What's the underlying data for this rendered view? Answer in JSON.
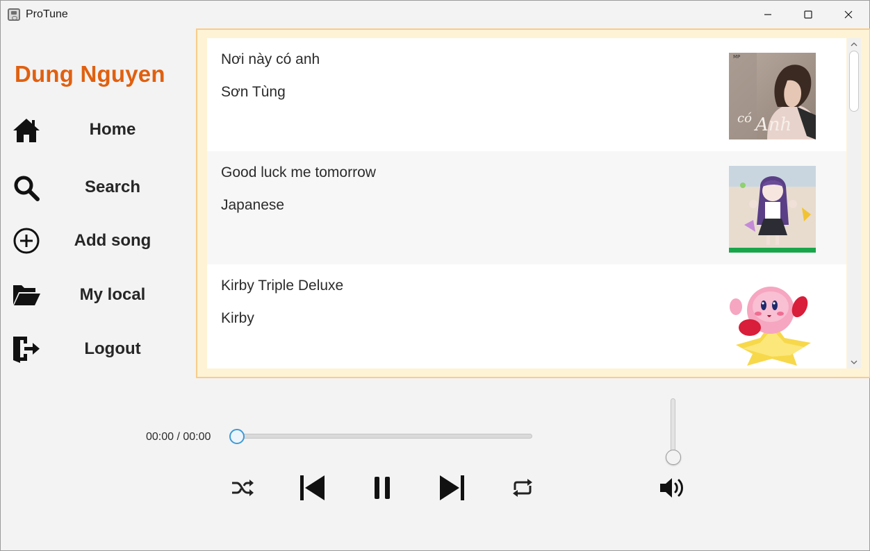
{
  "window": {
    "title": "ProTune"
  },
  "sidebar": {
    "user_name": "Dung Nguyen",
    "items": [
      {
        "label": "Home",
        "icon": "home-icon"
      },
      {
        "label": "Search",
        "icon": "search-icon"
      },
      {
        "label": "Add song",
        "icon": "add-circle-icon"
      },
      {
        "label": "My local",
        "icon": "folder-open-icon"
      },
      {
        "label": "Logout",
        "icon": "logout-icon"
      }
    ]
  },
  "songs": [
    {
      "title": "Nơi này có anh",
      "artist": "Sơn Tùng"
    },
    {
      "title": "Good luck me tomorrow",
      "artist": "Japanese"
    },
    {
      "title": "Kirby Triple Deluxe",
      "artist": "Kirby"
    }
  ],
  "player": {
    "time": "00:00 / 00:00",
    "progress_percent": 0,
    "volume_percent": 0,
    "controls": [
      "shuffle-icon",
      "previous-icon",
      "pause-icon",
      "next-icon",
      "repeat-icon",
      "volume-icon"
    ]
  },
  "colors": {
    "user_name": "#e06010",
    "list_border": "#f8cc8a",
    "slider_accent": "#3f9ad6"
  }
}
